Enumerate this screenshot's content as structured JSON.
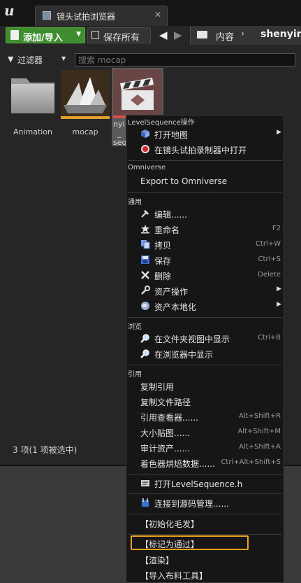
{
  "window": {
    "tab_title": "镜头试拍浏览器",
    "close_glyph": "✕"
  },
  "toolbar": {
    "add_import_label": "添加/导入",
    "save_all_label": "保存所有"
  },
  "breadcrumb": {
    "root": "内容",
    "separator": "›",
    "current": "shenyinw"
  },
  "filter": {
    "label": "过滤器",
    "search_placeholder": "搜索 mocap"
  },
  "assets": [
    {
      "name": "Animation"
    },
    {
      "name": "mocap"
    },
    {
      "name": "nyi",
      "name_line2": "_",
      "name_line3": "seq"
    }
  ],
  "status": "3 项(1 项被选中)",
  "menu": {
    "section_level_sequence": "LevelSequence操作",
    "open_map": "打开地图",
    "open_in_recorder": "在镜头试拍录制器中打开",
    "section_omniverse": "Omniverse",
    "export_omniverse": "Export to Omniverse",
    "section_common": "通用",
    "edit": "编辑......",
    "rename": "重命名",
    "rename_key": "F2",
    "copy": "拷贝",
    "copy_key": "Ctrl+W",
    "save": "保存",
    "save_key": "Ctrl+S",
    "delete": "删除",
    "delete_key": "Delete",
    "asset_actions": "资产操作",
    "asset_localize": "资产本地化",
    "section_browse": "浏览",
    "show_in_folder": "在文件夹视图中显示",
    "show_in_folder_key": "Ctrl+B",
    "show_in_browser": "在浏览器中显示",
    "section_reference": "引用",
    "copy_reference": "复制引用",
    "copy_file_path": "复制文件路径",
    "reference_viewer": "引用查看器......",
    "reference_viewer_key": "Alt+Shift+R",
    "size_map": "大小贴图......",
    "size_map_key": "Alt+Shift+M",
    "audit_assets": "审计资产......",
    "audit_assets_key": "Alt+Shift+A",
    "shader_cook": "着色器烘焙数据......",
    "shader_cook_key": "Ctrl+Alt+Shift+S",
    "open_header": "打开LevelSequence.h",
    "connect_source_control": "连接到源码管理......",
    "init_hair": "【初始化毛发】",
    "mark_passed": "【标记为通过】",
    "render": "【渲染】",
    "import_cloth": "【导入布料工具】"
  },
  "colors": {
    "accent_green": "#3f8d2e",
    "highlight_orange": "#f0a21c",
    "selection_underline": "#e0a030"
  }
}
